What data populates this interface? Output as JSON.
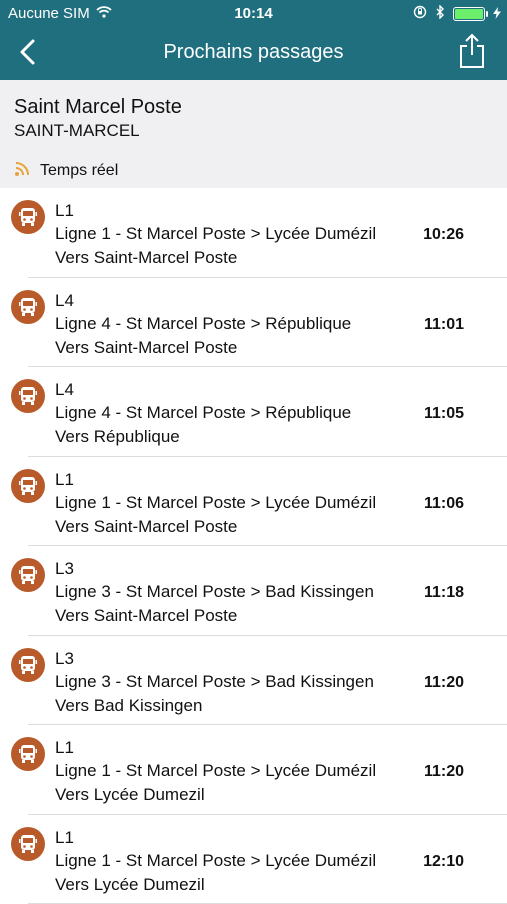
{
  "status": {
    "carrier": "Aucune SIM",
    "time": "10:14"
  },
  "nav": {
    "title": "Prochains passages",
    "back_icon": "chevron-left-icon",
    "share_icon": "share-icon"
  },
  "stop": {
    "name": "Saint Marcel Poste",
    "city": "SAINT-MARCEL",
    "realtime_label": "Temps réel"
  },
  "colors": {
    "header": "#1f6f7f",
    "bus_icon": "#b85a2a",
    "realtime_icon": "#e8a33a"
  },
  "departures": [
    {
      "line": "L1",
      "description": "Ligne 1 - St Marcel Poste > Lycée Dumézil",
      "direction": "Vers Saint-Marcel Poste",
      "time": "10:26"
    },
    {
      "line": "L4",
      "description": "Ligne 4 - St Marcel Poste > République",
      "direction": "Vers Saint-Marcel Poste",
      "time": "11:01"
    },
    {
      "line": "L4",
      "description": "Ligne 4 - St Marcel Poste > République",
      "direction": "Vers République",
      "time": "11:05"
    },
    {
      "line": "L1",
      "description": "Ligne 1 - St Marcel Poste > Lycée Dumézil",
      "direction": "Vers Saint-Marcel Poste",
      "time": "11:06"
    },
    {
      "line": "L3",
      "description": "Ligne 3 - St Marcel Poste > Bad Kissingen",
      "direction": "Vers Saint-Marcel Poste",
      "time": "11:18"
    },
    {
      "line": "L3",
      "description": "Ligne 3 - St Marcel Poste > Bad Kissingen",
      "direction": "Vers Bad Kissingen",
      "time": "11:20"
    },
    {
      "line": "L1",
      "description": "Ligne 1 - St Marcel Poste > Lycée Dumézil",
      "direction": "Vers Lycée Dumezil",
      "time": "11:20"
    },
    {
      "line": "L1",
      "description": "Ligne 1 - St Marcel Poste > Lycée Dumézil",
      "direction": "Vers Lycée Dumezil",
      "time": "12:10"
    }
  ]
}
